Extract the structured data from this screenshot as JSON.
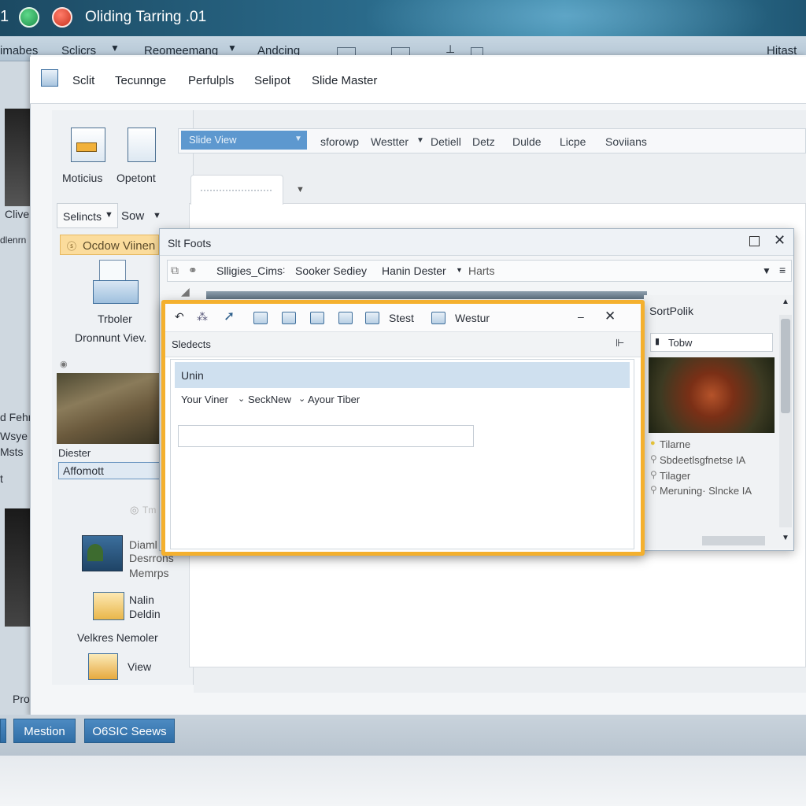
{
  "titlebar": {
    "number": "1",
    "title": "Oliding Tarring .01"
  },
  "menubar": {
    "items": [
      "imabes",
      "Sclicrs",
      "Reomeemang",
      "Andcing",
      "Hitast"
    ]
  },
  "ribbon": {
    "tabs": [
      "Sclit",
      "Tecunnge",
      "Perfulpls",
      "Selipot",
      "Slide Master"
    ]
  },
  "leftpanel": {
    "btn1": "Moticius",
    "btn2": "Opetont",
    "dd1": "Selincts",
    "dd2": "Sow",
    "active": "Ocdow  Viinen",
    "tool_label": "Trboler",
    "tool_label2": "Dronnunt Viev.",
    "thumb_label": "Diester",
    "thumb_input": "Affomott",
    "faint": "Tm",
    "item1a": "Diaml",
    "item1b": "Desrrons",
    "item1c": "Memrps",
    "item2a": "Nalin",
    "item2b": "Deldin",
    "item3": "Velkres Nemoler",
    "item4": "View"
  },
  "leftstrip": {
    "a": "Clive",
    "b": "dlenrn",
    "c": "d Fehn",
    "d": "Wsye",
    "e": "Msts",
    "f": "t",
    "g": "Pro"
  },
  "toolbar2": {
    "view": "Slide View",
    "items": [
      "sforowp",
      "Westter",
      "Detiell",
      "Detz",
      "Dulde",
      "Licpe",
      "Soviians"
    ]
  },
  "dialog1": {
    "title": "Slt Foots",
    "toolbar": [
      "Slligies_Cims",
      "Sooker Sediey",
      "Hanin Dester",
      "Harts"
    ],
    "side_title": "SortPolik",
    "search": "Tobw",
    "list": [
      "Tilarne",
      "Sbdeetlsgfnetse IA",
      "Tilager",
      "Meruning· Slncke IA"
    ]
  },
  "dialog2": {
    "tool_texts": [
      "Stest",
      "Westur"
    ],
    "sub_title": "Sledects",
    "row": "Unin",
    "options": [
      "Your Viner",
      "SeckNew",
      "Ayour Tiber"
    ]
  },
  "statusbar": {
    "btn1": "Mestion",
    "btn2": "O6SIC Seews"
  },
  "colors": {
    "accent": "#2f6ea6",
    "highlight_border": "#f4b02e",
    "title_bg": "#1c4a63"
  }
}
